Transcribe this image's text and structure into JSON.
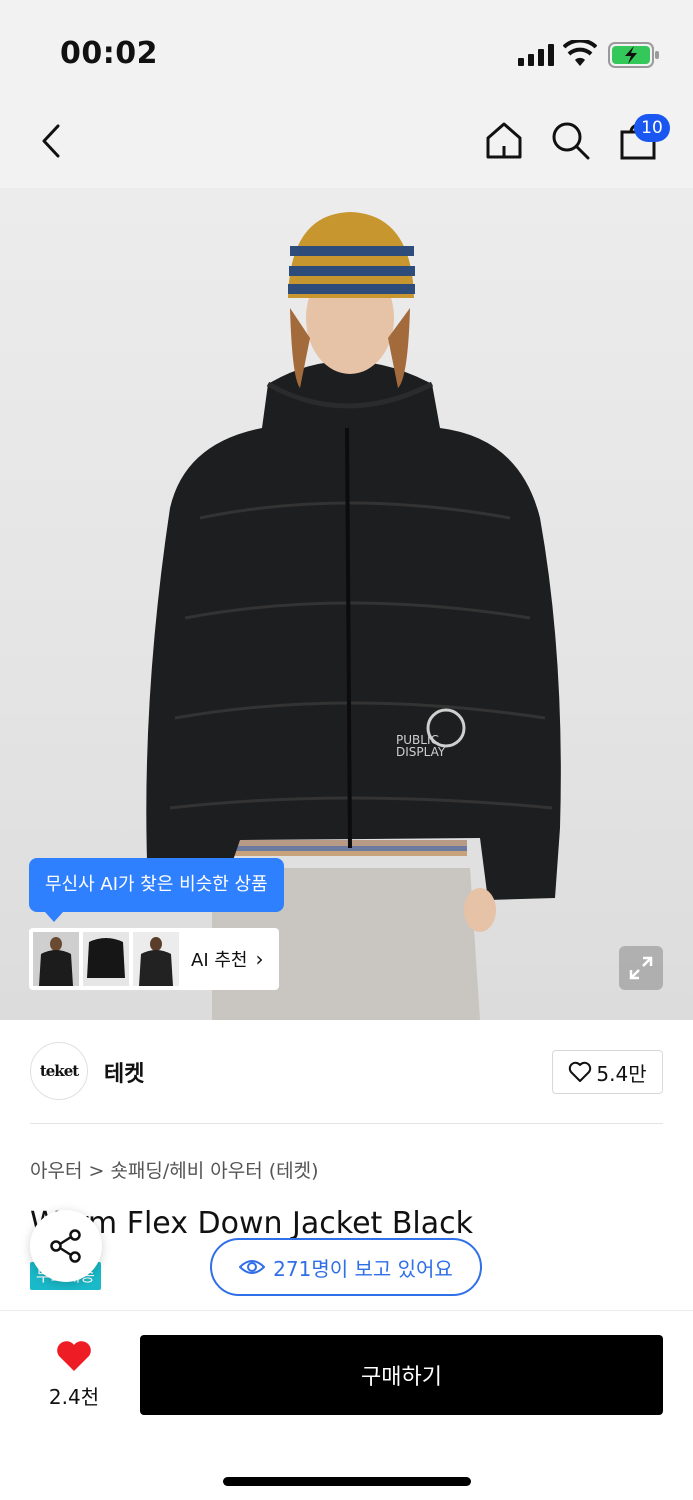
{
  "status_bar": {
    "time": "00:02"
  },
  "nav": {
    "cart_count": "10"
  },
  "hero": {
    "ai_tooltip": "무신사 AI가 찾은 비슷한 상품",
    "ai_recommend_label": "AI 추천",
    "chevron": "›"
  },
  "brand": {
    "logo_text": "teket",
    "name": "테켓",
    "like_count": "5.4만"
  },
  "product": {
    "breadcrumb": "아우터 > 숏패딩/헤비 아우터 (테켓)",
    "title": "Warm Flex Down Jacket Black",
    "free_shipping": "무료배송"
  },
  "viewers": {
    "text": "271명이 보고 있어요"
  },
  "bottom": {
    "heart_count": "2.4천",
    "buy_label": "구매하기"
  },
  "colors": {
    "accent_blue": "#2f6fe8",
    "tooltip_blue": "#2f80ff",
    "badge_blue": "#1a56f0",
    "heart_red": "#ee1c25",
    "free_ship_teal": "#19b9c9"
  }
}
